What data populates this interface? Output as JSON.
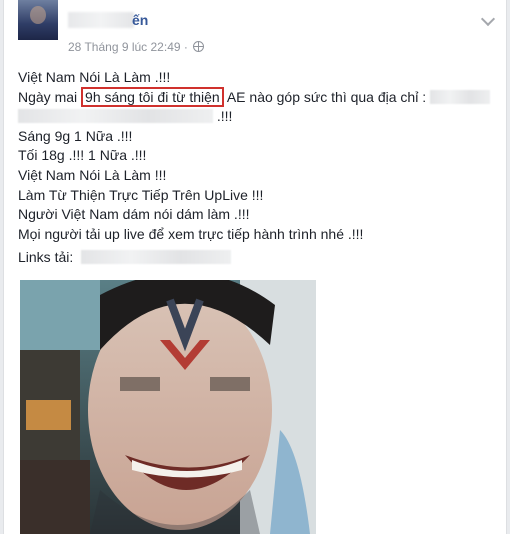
{
  "post": {
    "author_suffix": "ến",
    "timestamp": "28 Tháng 9 lúc 22:49 ·",
    "privacy_icon": "globe-icon",
    "menu_icon": "chevron-down-icon",
    "lines": {
      "l1": "Việt Nam Nói Là Làm .!!!",
      "l2_pre": "Ngày mai ",
      "l2_highlight": "9h sáng tôi đi từ thiện",
      "l2_post": " AE nào góp sức thì qua địa chỉ :",
      "l3_post": ".!!!",
      "l4": "Sáng 9g 1 Nữa .!!!",
      "l5": "Tối 18g .!!! 1 Nữa .!!!",
      "l6": "Việt Nam Nói Là Làm !!!",
      "l7": "Làm Từ Thiện Trực Tiếp Trên UpLive !!!",
      "l8": "Người Việt Nam dám nói dám làm .!!!",
      "l9": "Mọi người tải up live để xem trực tiếp hành trình nhé .!!!",
      "l10": "Links tải:"
    },
    "highlight_color": "#d0312d",
    "link_color": "#365899"
  }
}
